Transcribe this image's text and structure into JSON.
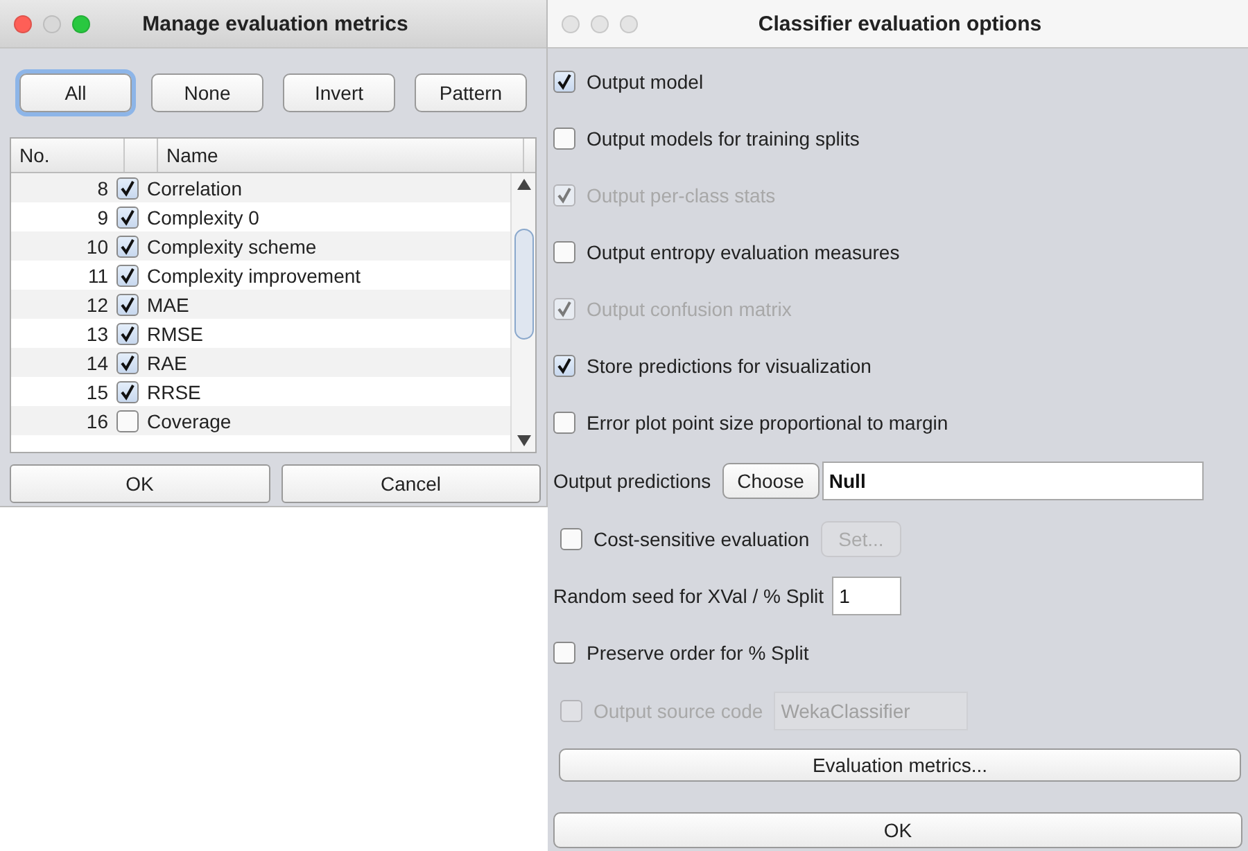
{
  "metrics_window": {
    "title": "Manage evaluation metrics",
    "focused": true,
    "buttons": [
      {
        "label": "All",
        "focused": true
      },
      {
        "label": "None",
        "focused": false
      },
      {
        "label": "Invert",
        "focused": false
      },
      {
        "label": "Pattern",
        "focused": false
      }
    ],
    "columns": [
      "No.",
      "Name"
    ],
    "rows": [
      {
        "no": "8",
        "name": "Correlation",
        "checked": true
      },
      {
        "no": "9",
        "name": "Complexity 0",
        "checked": true
      },
      {
        "no": "10",
        "name": "Complexity scheme",
        "checked": true
      },
      {
        "no": "11",
        "name": "Complexity improvement",
        "checked": true
      },
      {
        "no": "12",
        "name": "MAE",
        "checked": true
      },
      {
        "no": "13",
        "name": "RMSE",
        "checked": true
      },
      {
        "no": "14",
        "name": "RAE",
        "checked": true
      },
      {
        "no": "15",
        "name": "RRSE",
        "checked": true
      },
      {
        "no": "16",
        "name": "Coverage",
        "checked": false
      }
    ],
    "footer_buttons": [
      "OK",
      "Cancel"
    ]
  },
  "options_window": {
    "title": "Classifier evaluation options",
    "focused": false,
    "items": [
      {
        "kind": "checkbox",
        "label": "Output model",
        "checked": true,
        "disabled": false
      },
      {
        "kind": "checkbox",
        "label": "Output models for training splits",
        "checked": false,
        "disabled": false
      },
      {
        "kind": "checkbox",
        "label": "Output per-class stats",
        "checked": true,
        "disabled": true
      },
      {
        "kind": "checkbox",
        "label": "Output entropy evaluation measures",
        "checked": false,
        "disabled": false
      },
      {
        "kind": "checkbox",
        "label": "Output confusion matrix",
        "checked": true,
        "disabled": true
      },
      {
        "kind": "checkbox",
        "label": "Store predictions for visualization",
        "checked": true,
        "disabled": false
      },
      {
        "kind": "checkbox",
        "label": "Error plot point size proportional to margin",
        "checked": false,
        "disabled": false
      },
      {
        "kind": "chooser",
        "label": "Output predictions",
        "button": "Choose",
        "value": "Null"
      },
      {
        "kind": "checkbox-button",
        "label": "Cost-sensitive evaluation",
        "checked": false,
        "disabled": false,
        "button": "Set...",
        "button_disabled": true
      },
      {
        "kind": "text-field",
        "label": "Random seed for XVal / % Split",
        "value": "1"
      },
      {
        "kind": "checkbox",
        "label": "Preserve order for % Split",
        "checked": false,
        "disabled": false
      },
      {
        "kind": "checkbox-field",
        "label": "Output source code",
        "checked": false,
        "disabled": true,
        "value": "WekaClassifier"
      },
      {
        "kind": "wide-button",
        "label": "Evaluation metrics..."
      }
    ],
    "ok_button": "OK"
  }
}
